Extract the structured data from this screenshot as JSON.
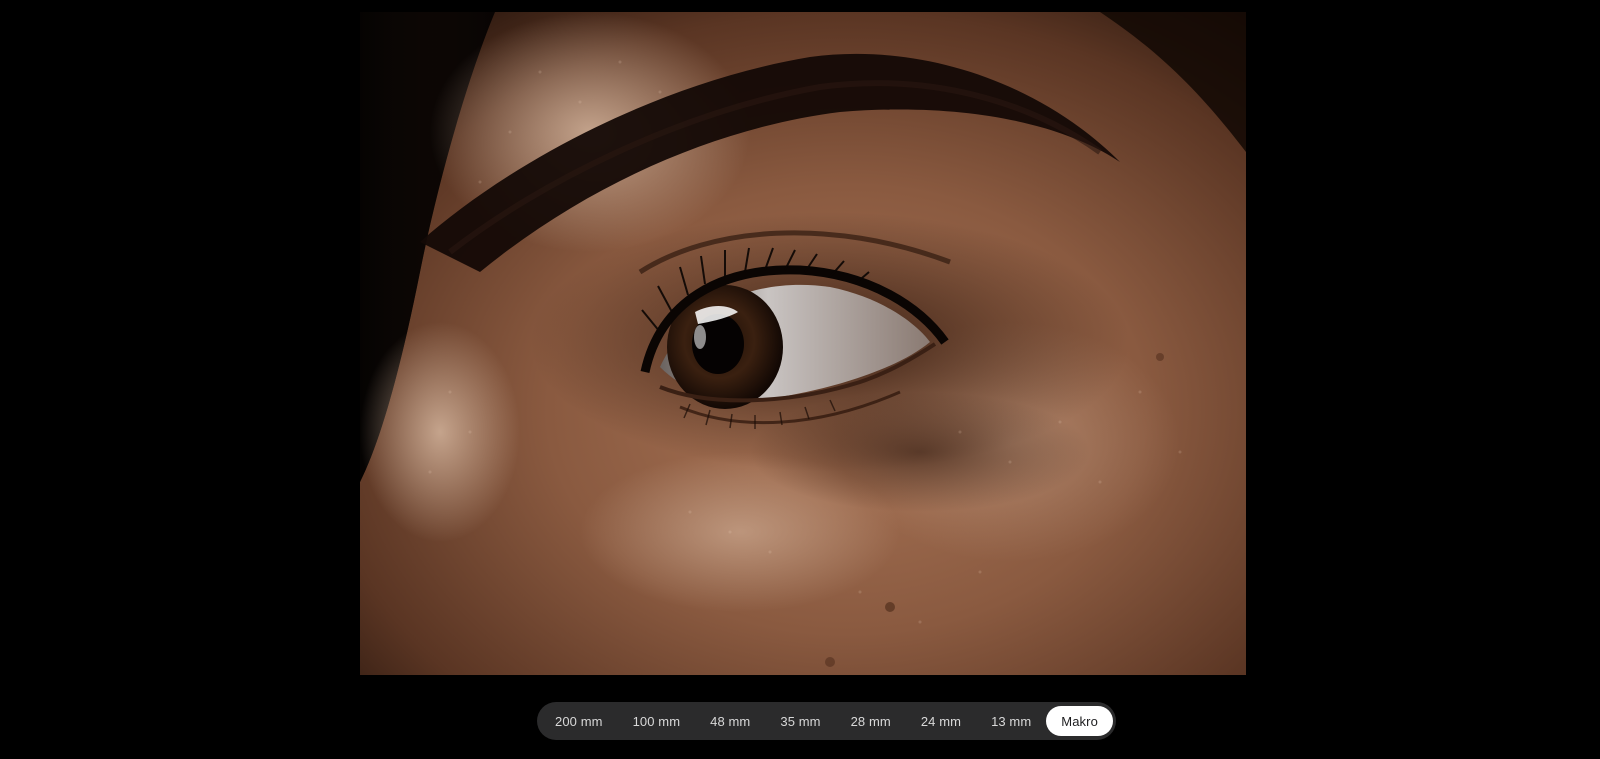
{
  "photo": {
    "subject": "eye-closeup"
  },
  "lens_selector": {
    "active_index": 7,
    "options": [
      {
        "label": "200 mm"
      },
      {
        "label": "100 mm"
      },
      {
        "label": "48 mm"
      },
      {
        "label": "35 mm"
      },
      {
        "label": "28 mm"
      },
      {
        "label": "24 mm"
      },
      {
        "label": "13 mm"
      },
      {
        "label": "Makro"
      }
    ]
  },
  "colors": {
    "background": "#000000",
    "bar_background": "#2b2b2c",
    "active_pill": "#ffffff",
    "inactive_text": "#d8d8d8",
    "active_text": "#1d1d1f"
  }
}
